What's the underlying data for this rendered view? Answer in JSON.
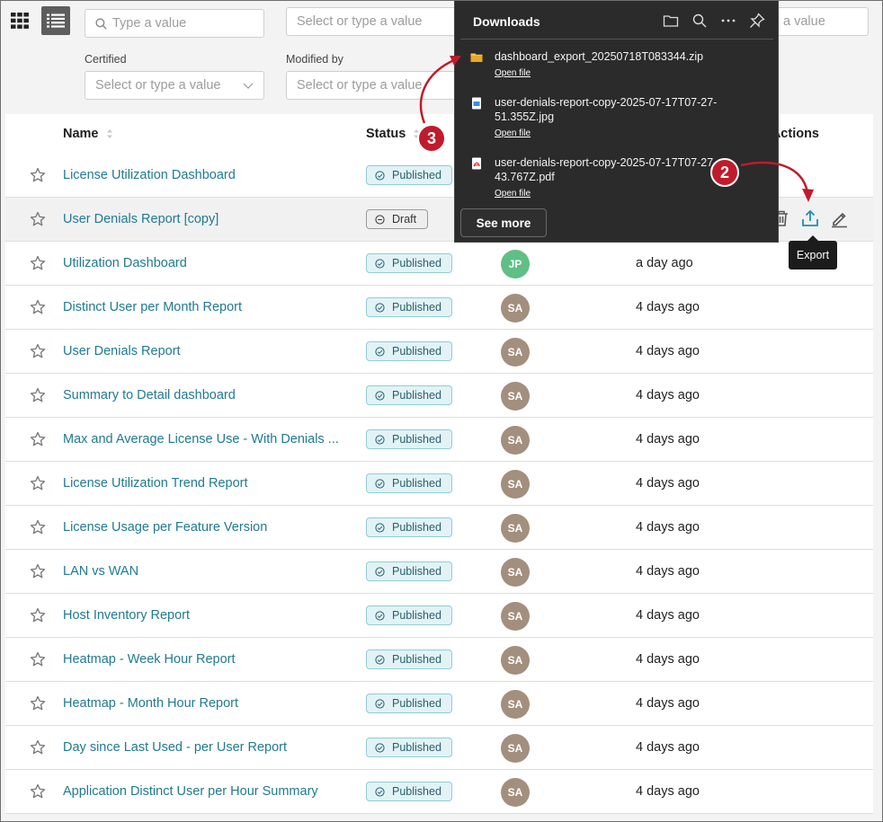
{
  "toolbar": {
    "search_placeholder": "Type a value",
    "select_placeholder_1": "Select or type a value",
    "select_placeholder_3": "a value"
  },
  "filters": [
    {
      "label": "Certified",
      "placeholder": "Select or type a value"
    },
    {
      "label": "Modified by",
      "placeholder": "Select or type a value"
    }
  ],
  "table": {
    "columns": {
      "name": "Name",
      "status": "Status",
      "actions": "Actions"
    },
    "rows": [
      {
        "name": "License Utilization Dashboard",
        "status": "Published",
        "owner": "",
        "modified": ""
      },
      {
        "name": "User Denials Report [copy]",
        "status": "Draft",
        "owner": "",
        "modified": ""
      },
      {
        "name": "Utilization Dashboard",
        "status": "Published",
        "owner": "JP",
        "modified": "a day ago"
      },
      {
        "name": "Distinct User per Month Report",
        "status": "Published",
        "owner": "SA",
        "modified": "4 days ago"
      },
      {
        "name": "User Denials Report",
        "status": "Published",
        "owner": "SA",
        "modified": "4 days ago"
      },
      {
        "name": "Summary to Detail dashboard",
        "status": "Published",
        "owner": "SA",
        "modified": "4 days ago"
      },
      {
        "name": "Max and Average License Use - With Denials ...",
        "status": "Published",
        "owner": "SA",
        "modified": "4 days ago"
      },
      {
        "name": "License Utilization Trend Report",
        "status": "Published",
        "owner": "SA",
        "modified": "4 days ago"
      },
      {
        "name": "License Usage per Feature Version",
        "status": "Published",
        "owner": "SA",
        "modified": "4 days ago"
      },
      {
        "name": "LAN vs WAN",
        "status": "Published",
        "owner": "SA",
        "modified": "4 days ago"
      },
      {
        "name": "Host Inventory Report",
        "status": "Published",
        "owner": "SA",
        "modified": "4 days ago"
      },
      {
        "name": "Heatmap - Week Hour Report",
        "status": "Published",
        "owner": "SA",
        "modified": "4 days ago"
      },
      {
        "name": "Heatmap - Month Hour Report",
        "status": "Published",
        "owner": "SA",
        "modified": "4 days ago"
      },
      {
        "name": "Day since Last Used - per User Report",
        "status": "Published",
        "owner": "SA",
        "modified": "4 days ago"
      },
      {
        "name": "Application Distinct User per Hour Summary",
        "status": "Published",
        "owner": "SA",
        "modified": "4 days ago"
      }
    ]
  },
  "tooltip": {
    "export": "Export"
  },
  "downloads": {
    "title": "Downloads",
    "items": [
      {
        "filename": "dashboard_export_20250718T083344.zip",
        "action": "Open file",
        "icon": "folder-icon"
      },
      {
        "filename": "user-denials-report-copy-2025-07-17T07-27-51.355Z.jpg",
        "action": "Open file",
        "icon": "image-file-icon"
      },
      {
        "filename": "user-denials-report-copy-2025-07-17T07-27-43.767Z.pdf",
        "action": "Open file",
        "icon": "pdf-file-icon"
      }
    ],
    "see_more": "See more"
  },
  "annotations": {
    "step_2": "2",
    "step_3": "3"
  },
  "colors": {
    "link": "#1f7a92",
    "published_bg": "#e2f2f5",
    "annotation": "#c01b2c",
    "panel_bg": "#2b2b2b"
  }
}
